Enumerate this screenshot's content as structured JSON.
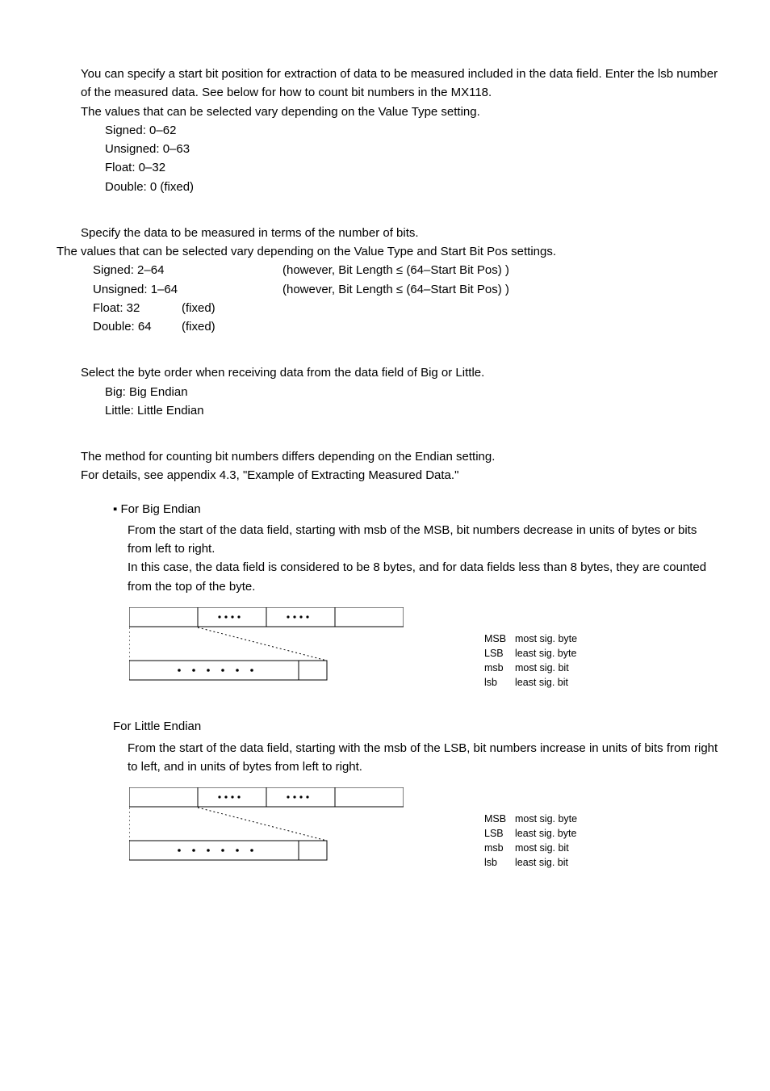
{
  "startbit": {
    "p1": "You can specify a start bit position for extraction of data to be measured included in the data field. Enter the lsb number of the measured data. See below for how to count bit numbers in the MX118.",
    "p2": "The values that can be selected vary depending on the Value Type setting.",
    "items": {
      "signed": "Signed: 0–62",
      "unsigned": "Unsigned: 0–63",
      "float": "Float: 0–32",
      "double": "Double: 0 (fixed)"
    }
  },
  "bitlen": {
    "p1": "Specify the data to be measured in terms of the number of bits.",
    "p2": "The values that can be selected vary depending on the Value Type and Start Bit Pos settings.",
    "rows": {
      "signed": {
        "c1": "Signed: 2–64",
        "c2": "",
        "c3": "(however, Bit Length ≤ (64–Start Bit Pos) )"
      },
      "unsigned": {
        "c1": "Unsigned: 1–64",
        "c2": "",
        "c3": "(however, Bit Length ≤ (64–Start Bit Pos) )"
      },
      "float": {
        "c1": "Float: 32",
        "c2": "(fixed)",
        "c3": ""
      },
      "double": {
        "c1": "Double: 64",
        "c2": "(fixed)",
        "c3": ""
      }
    }
  },
  "endian": {
    "p1": "Select the byte order when receiving data from the data field of Big or Little.",
    "items": {
      "big": "Big: Big Endian",
      "little": "Little: Little Endian"
    }
  },
  "counting": {
    "p1": "The method for counting bit numbers differs depending on the Endian setting.",
    "p2": "For details, see appendix 4.3, \"Example of Extracting Measured Data.\"",
    "big": {
      "head": "▪ For Big Endian",
      "body1": "From the start of the data field, starting with msb of the MSB, bit numbers decrease in units of bytes or bits from left to right.",
      "body2": "In this case, the data field is considered to be 8 bytes, and for data fields less than 8 bytes, they are counted from the top of the byte."
    },
    "little": {
      "head": "For Little Endian",
      "body1": "From the start of the data field, starting with the msb of the LSB, bit numbers increase in units of bits from right to left, and in units of bytes from left to right."
    }
  },
  "legend": {
    "msb_u": {
      "abbr": "MSB",
      "def": "most sig. byte"
    },
    "lsb_u": {
      "abbr": "LSB",
      "def": "least sig. byte"
    },
    "msb_l": {
      "abbr": "msb",
      "def": "most sig. bit"
    },
    "lsb_l": {
      "abbr": "lsb",
      "def": "least sig. bit"
    }
  }
}
